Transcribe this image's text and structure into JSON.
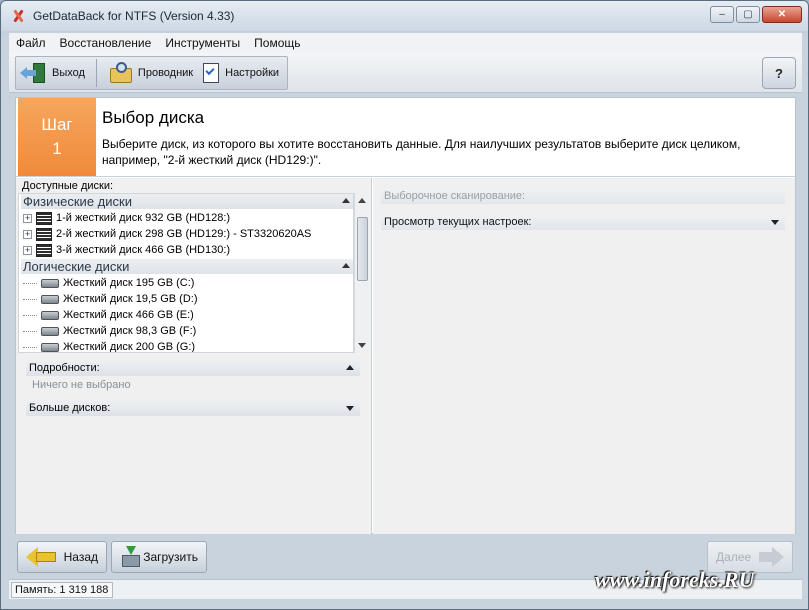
{
  "window": {
    "title": "GetDataBack for NTFS (Version 4.33)"
  },
  "menu": [
    "Файл",
    "Восстановление",
    "Инструменты",
    "Помощь"
  ],
  "toolbar": {
    "exit": "Выход",
    "explorer": "Проводник",
    "settings": "Настройки",
    "help": "?"
  },
  "header": {
    "step_word": "Шаг",
    "step_number": "1",
    "title": "Выбор диска",
    "description": "Выберите диск, из которого вы хотите восстановить данные. Для наилучших результатов выберите диск целиком, например, \"2-й жесткий диск (HD129:)\"."
  },
  "left": {
    "available_label": "Доступные диски:",
    "physical_group": "Физические диски",
    "physical_disks": [
      "1-й жесткий диск 932 GB (HD128:)",
      "2-й жесткий диск 298 GB (HD129:) - ST3320620AS",
      "3-й жесткий диск 466 GB (HD130:)"
    ],
    "logical_group": "Логические диски",
    "logical_disks": [
      "Жесткий диск 195 GB (C:)",
      "Жесткий диск 19,5 GB (D:)",
      "Жесткий диск 466 GB (E:)",
      "Жесткий диск 98,3 GB (F:)",
      "Жесткий диск 200 GB (G:)"
    ],
    "details_label": "Подробности:",
    "details_value": "Ничего не выбрано",
    "more_disks": "Больше дисков:"
  },
  "right": {
    "selective_scan": "Выборочное сканирование:",
    "view_settings": "Просмотр текущих настроек:"
  },
  "buttons": {
    "back": "Назад",
    "load": "Загрузить",
    "next": "Далее"
  },
  "status": {
    "memory": "Память: 1 319 188"
  },
  "watermark": "www.inforeks.RU",
  "colors": {
    "step_accent": "#f08a3a"
  }
}
